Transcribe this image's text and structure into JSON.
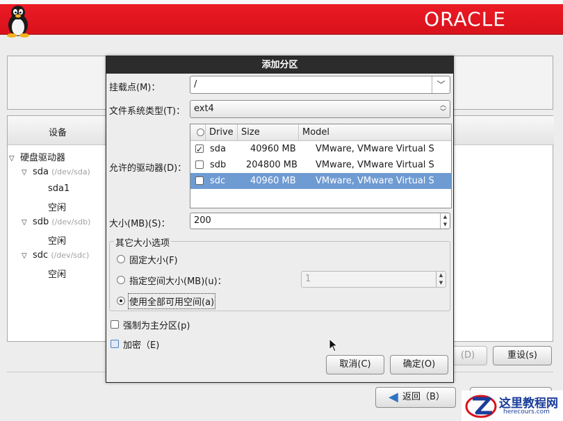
{
  "banner": {
    "brand": "ORACLE"
  },
  "background": {
    "device_column": "设备",
    "tree": [
      {
        "label": "硬盘驱动器",
        "path": "",
        "level": 0,
        "expanded": true
      },
      {
        "label": "sda",
        "path": "(/dev/sda)",
        "level": 1,
        "expanded": true
      },
      {
        "label": "sda1",
        "path": "",
        "level": 2
      },
      {
        "label": "空闲",
        "path": "",
        "level": 2
      },
      {
        "label": "sdb",
        "path": "(/dev/sdb)",
        "level": 1,
        "expanded": true
      },
      {
        "label": "空闲",
        "path": "",
        "level": 2
      },
      {
        "label": "sdc",
        "path": "(/dev/sdc)",
        "level": 1,
        "expanded": true
      },
      {
        "label": "空闲",
        "path": "",
        "level": 2
      }
    ],
    "delete_label": "(D)",
    "reset_label": "重设(s)",
    "back_label": "返回（B）"
  },
  "watermark": {
    "title": "这里教程网",
    "url": "herecours.com"
  },
  "dialog": {
    "title": "添加分区",
    "mount_label": "挂载点(M)：",
    "mount_value": "/",
    "fstype_label": "文件系统类型(T)：",
    "fstype_value": "ext4",
    "drives_label": "允许的驱动器(D)：",
    "drive_columns": [
      "Drive",
      "Size",
      "Model"
    ],
    "drives": [
      {
        "drive": "sda",
        "size": "40960 MB",
        "model": "VMware, VMware Virtual S",
        "checked": true,
        "selected": false
      },
      {
        "drive": "sdb",
        "size": "204800 MB",
        "model": "VMware, VMware Virtual S",
        "checked": false,
        "selected": false
      },
      {
        "drive": "sdc",
        "size": "40960 MB",
        "model": "VMware, VMware Virtual S",
        "checked": false,
        "selected": true
      }
    ],
    "size_label": "大小(MB)(S)：",
    "size_value": "200",
    "other_options_title": "其它大小选项",
    "opt_fixed": "固定大小(F)",
    "opt_upto": "指定空间大小(MB)(u)：",
    "opt_upto_value": "1",
    "opt_fill": "使用全部可用空间(a)",
    "primary_label": "强制为主分区(p)",
    "encrypt_label": "加密（E)",
    "cancel_label": "取消(C)",
    "ok_label": "确定(O)",
    "selected_size_option": "fill"
  }
}
